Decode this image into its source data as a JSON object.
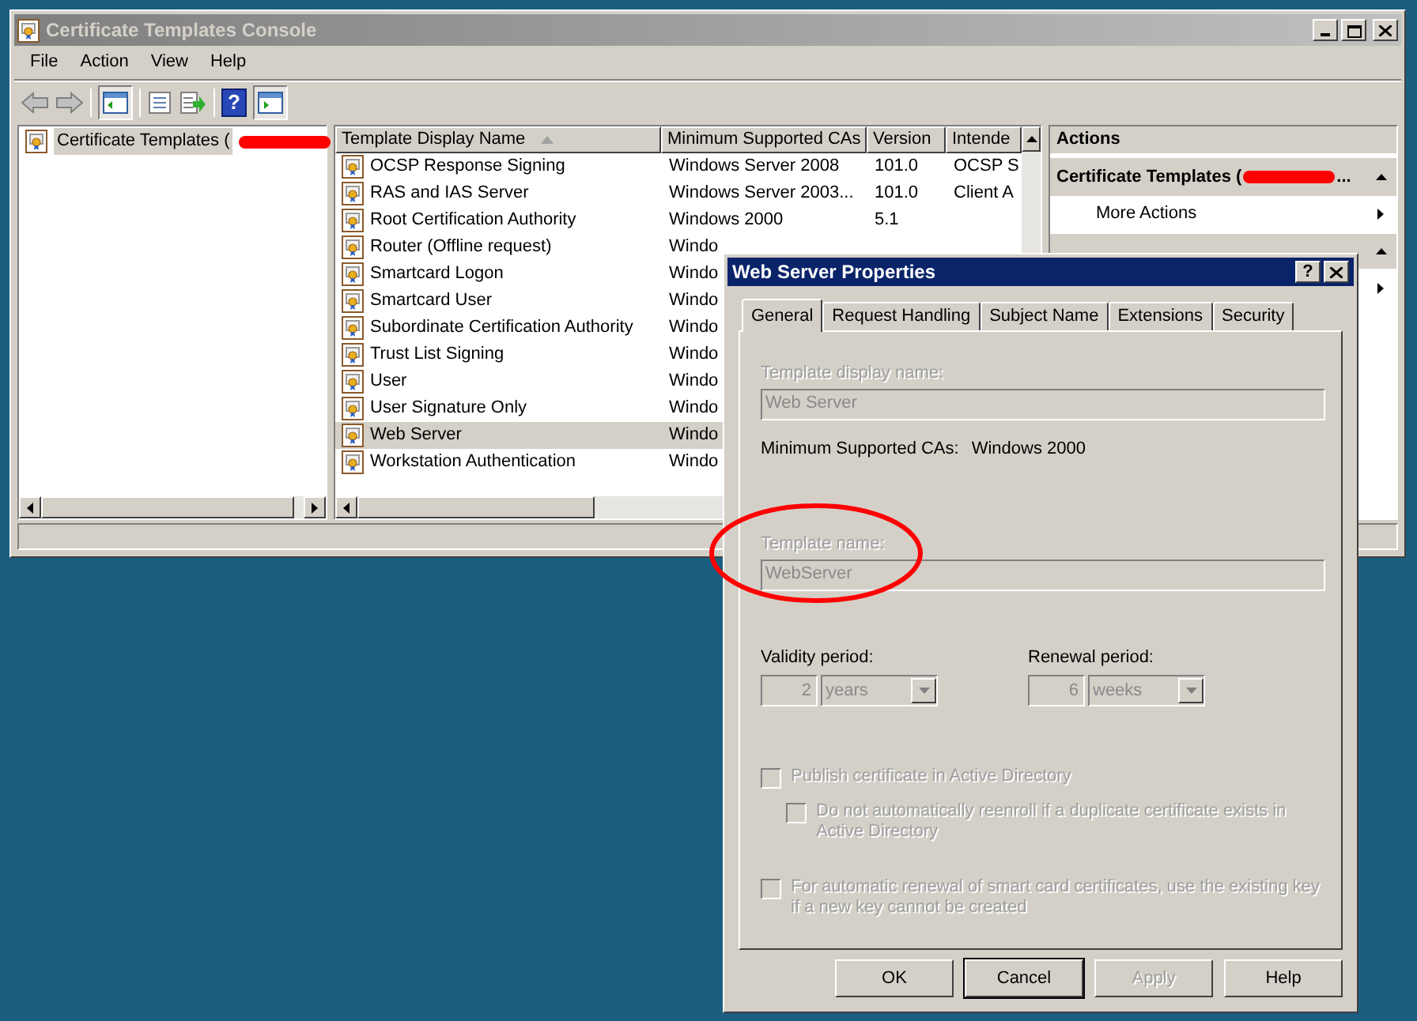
{
  "window": {
    "title": "Certificate Templates Console"
  },
  "menu": [
    {
      "label": "File"
    },
    {
      "label": "Action"
    },
    {
      "label": "View"
    },
    {
      "label": "Help"
    }
  ],
  "toolbar": {
    "help_glyph": "?"
  },
  "tree": {
    "items": [
      {
        "label": "Certificate Templates (",
        "selected": true
      }
    ]
  },
  "list": {
    "columns": [
      {
        "label": "Template Display Name",
        "sorted": true
      },
      {
        "label": "Minimum Supported CAs",
        "sorted": false
      },
      {
        "label": "Version",
        "sorted": false
      },
      {
        "label": "Intende",
        "sorted": false
      }
    ],
    "rows": [
      {
        "cells": [
          "OCSP Response Signing",
          "Windows Server 2008",
          "101.0",
          "OCSP S"
        ],
        "selected": false
      },
      {
        "cells": [
          "RAS and IAS Server",
          "Windows Server 2003...",
          "101.0",
          "Client A"
        ],
        "selected": false
      },
      {
        "cells": [
          "Root Certification Authority",
          "Windows 2000",
          "5.1"
        ],
        "selected": false
      },
      {
        "cells": [
          "Router (Offline request)",
          "Windo"
        ],
        "selected": false
      },
      {
        "cells": [
          "Smartcard Logon",
          "Windo"
        ],
        "selected": false
      },
      {
        "cells": [
          "Smartcard User",
          "Windo"
        ],
        "selected": false
      },
      {
        "cells": [
          "Subordinate Certification Authority",
          "Windo"
        ],
        "selected": false
      },
      {
        "cells": [
          "Trust List Signing",
          "Windo"
        ],
        "selected": false
      },
      {
        "cells": [
          "User",
          "Windo"
        ],
        "selected": false
      },
      {
        "cells": [
          "User Signature Only",
          "Windo"
        ],
        "selected": false
      },
      {
        "cells": [
          "Web Server",
          "Windo"
        ],
        "selected": true
      },
      {
        "cells": [
          "Workstation Authentication",
          "Windo"
        ],
        "selected": false
      }
    ]
  },
  "actions": {
    "title": "Actions",
    "sections": [
      {
        "heading": "Certificate Templates (",
        "ellipsis": "...",
        "items": [
          {
            "label": "More Actions"
          }
        ]
      }
    ]
  },
  "dialog": {
    "title": "Web Server Properties",
    "help_glyph": "?",
    "tabs": [
      {
        "label": "General",
        "selected": true
      },
      {
        "label": "Request Handling",
        "selected": false
      },
      {
        "label": "Subject Name",
        "selected": false
      },
      {
        "label": "Extensions",
        "selected": false
      },
      {
        "label": "Security",
        "selected": false
      }
    ],
    "display_name": {
      "label": "Template display name:",
      "value": "Web Server",
      "disabled": true
    },
    "min_cas": {
      "label": "Minimum Supported CAs:",
      "value": "Windows 2000"
    },
    "template_name": {
      "label": "Template name:",
      "value": "WebServer",
      "disabled": true
    },
    "periods": [
      {
        "label": "Validity period:",
        "number": "2",
        "unit": "years",
        "disabled": true
      },
      {
        "label": "Renewal period:",
        "number": "6",
        "unit": "weeks",
        "disabled": true
      }
    ],
    "checkboxes": [
      {
        "label": "Publish certificate in Active Directory",
        "checked": false,
        "disabled": true,
        "children": [
          {
            "label": "Do not automatically reenroll if a duplicate certificate exists in Active Directory",
            "checked": false,
            "disabled": true
          }
        ]
      },
      {
        "label": "For automatic renewal of smart card certificates, use the existing key if a new key cannot be created",
        "checked": false,
        "disabled": true
      }
    ],
    "buttons": [
      {
        "label": "OK",
        "default": false,
        "disabled": false
      },
      {
        "label": "Cancel",
        "default": true,
        "disabled": false
      },
      {
        "label": "Apply",
        "default": false,
        "disabled": true
      },
      {
        "label": "Help",
        "default": false,
        "disabled": false
      }
    ]
  }
}
